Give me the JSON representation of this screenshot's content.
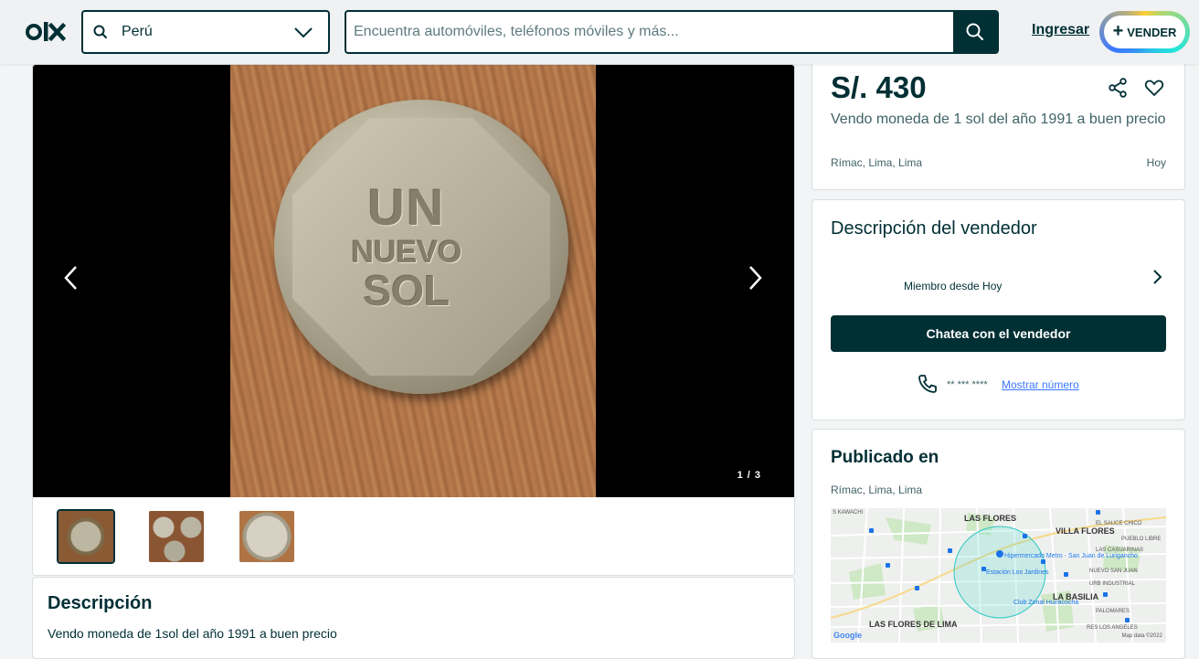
{
  "header": {
    "logo_alt": "OLX",
    "location": "Perú",
    "search_placeholder": "Encuentra automóviles, teléfonos móviles y más...",
    "login_label": "Ingresar",
    "sell_label": "VENDER",
    "accent_color": "#002f34"
  },
  "gallery": {
    "image_counter": "1 / 3",
    "coin_text": [
      "UN",
      "NUEVO",
      "SOL"
    ],
    "thumbnail_count": 3,
    "active_thumbnail": 1
  },
  "description": {
    "title": "Descripción",
    "text": "Vendo moneda de 1sol del año 1991 a buen precio"
  },
  "ad": {
    "price": "S/. 430",
    "title": "Vendo moneda de 1 sol del año 1991 a buen precio",
    "location": "Rímac, Lima, Lima",
    "date": "Hoy"
  },
  "seller": {
    "title": "Descripción del vendedor",
    "member_since": "Miembro desde Hoy",
    "chat_label": "Chatea con el vendedor",
    "phone_masked": "** *** ****",
    "show_number_label": "Mostrar número"
  },
  "published": {
    "title": "Publicado en",
    "location": "Rímac, Lima, Lima",
    "map_labels": {
      "las_flores": "LAS FLORES",
      "villa_flores": "VILLA FLORES",
      "la_basilia": "LA BASILIA",
      "las_flores_lima": "LAS FLORES DE LIMA",
      "hipermercado": "Hipermercado Metro - San Juan de Lurigancho",
      "estacion": "Estación Los Jardines",
      "club_zonal": "Club Zonal Huiracocha",
      "kawachi": "S KAWACHI",
      "el_sauce": "EL SAUCE CHICO",
      "pueblo_libre": "PUEBLO LIBRE",
      "casuarinas": "LAS CASUARINAS",
      "nuevo_san_juan": "NUEVO SAN JUAN",
      "urb_industrial": "URB INDUSTRIAL",
      "palomares": "PALOMARES",
      "res_los_angeles": "RES LOS ANGELES",
      "google": "Google",
      "map_credit": "Map data ©2022"
    }
  }
}
